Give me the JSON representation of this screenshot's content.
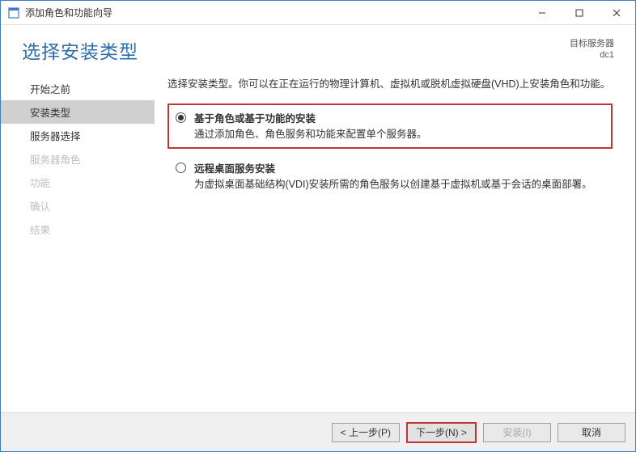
{
  "window": {
    "title": "添加角色和功能向导"
  },
  "header": {
    "title": "选择安装类型",
    "target_label": "目标服务器",
    "target_value": "dc1"
  },
  "sidebar": {
    "items": [
      {
        "label": "开始之前",
        "state": "normal"
      },
      {
        "label": "安装类型",
        "state": "active"
      },
      {
        "label": "服务器选择",
        "state": "normal"
      },
      {
        "label": "服务器角色",
        "state": "disabled"
      },
      {
        "label": "功能",
        "state": "disabled"
      },
      {
        "label": "确认",
        "state": "disabled"
      },
      {
        "label": "结果",
        "state": "disabled"
      }
    ]
  },
  "content": {
    "description": "选择安装类型。你可以在正在运行的物理计算机、虚拟机或脱机虚拟硬盘(VHD)上安装角色和功能。",
    "options": [
      {
        "title": "基于角色或基于功能的安装",
        "desc": "通过添加角色、角色服务和功能来配置单个服务器。",
        "selected": true,
        "highlight": true
      },
      {
        "title": "远程桌面服务安装",
        "desc": "为虚拟桌面基础结构(VDI)安装所需的角色服务以创建基于虚拟机或基于会话的桌面部署。",
        "selected": false,
        "highlight": false
      }
    ]
  },
  "footer": {
    "previous": "< 上一步(P)",
    "next": "下一步(N) >",
    "install": "安装(I)",
    "cancel": "取消"
  }
}
